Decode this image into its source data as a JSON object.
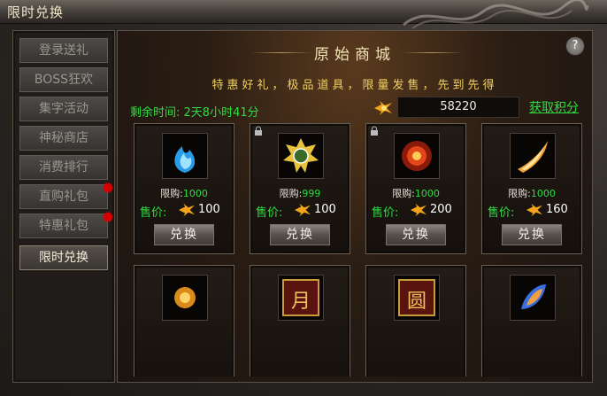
{
  "window": {
    "title": "限时兑换"
  },
  "sidebar": {
    "items": [
      {
        "label": "登录送礼",
        "active": false,
        "badge": false
      },
      {
        "label": "BOSS狂欢",
        "active": false,
        "badge": false
      },
      {
        "label": "集字活动",
        "active": false,
        "badge": false
      },
      {
        "label": "神秘商店",
        "active": false,
        "badge": false
      },
      {
        "label": "消费排行",
        "active": false,
        "badge": false
      },
      {
        "label": "直购礼包",
        "active": false,
        "badge": true
      },
      {
        "label": "特惠礼包",
        "active": false,
        "badge": true
      },
      {
        "label": "限时兑换",
        "active": true,
        "badge": false
      }
    ]
  },
  "shop": {
    "title": "原始商城",
    "slogan": "特惠好礼，极品道具，限量发售，先到先得",
    "help": "?",
    "timer_label": "剩余时间:",
    "timer_value": "2天8小时41分",
    "points": "58220",
    "get_points": "获取积分",
    "items": [
      {
        "icon": "blue-flame-icon",
        "locked": false,
        "limit_label": "限购:",
        "limit": "1000",
        "price_label": "售价:",
        "price": "100",
        "button": "兑换"
      },
      {
        "icon": "gold-seal-icon",
        "locked": true,
        "limit_label": "限购:",
        "limit": "999",
        "price_label": "售价:",
        "price": "100",
        "button": "兑换"
      },
      {
        "icon": "fire-orb-icon",
        "locked": true,
        "limit_label": "限购:",
        "limit": "1000",
        "price_label": "售价:",
        "price": "200",
        "button": "兑换"
      },
      {
        "icon": "flame-blade-icon",
        "locked": false,
        "limit_label": "限购:",
        "limit": "1000",
        "price_label": "售价:",
        "price": "160",
        "button": "兑换"
      },
      {
        "icon": "amber-gem-icon",
        "locked": false
      },
      {
        "icon": "moon-token-icon",
        "locked": false,
        "glyph": "月"
      },
      {
        "icon": "circle-token-icon",
        "locked": false,
        "glyph": "圆"
      },
      {
        "icon": "spirit-stone-icon",
        "locked": false
      }
    ]
  },
  "colors": {
    "green": "#2fdc40",
    "gold": "#f0d060",
    "badge": "#d60000"
  }
}
